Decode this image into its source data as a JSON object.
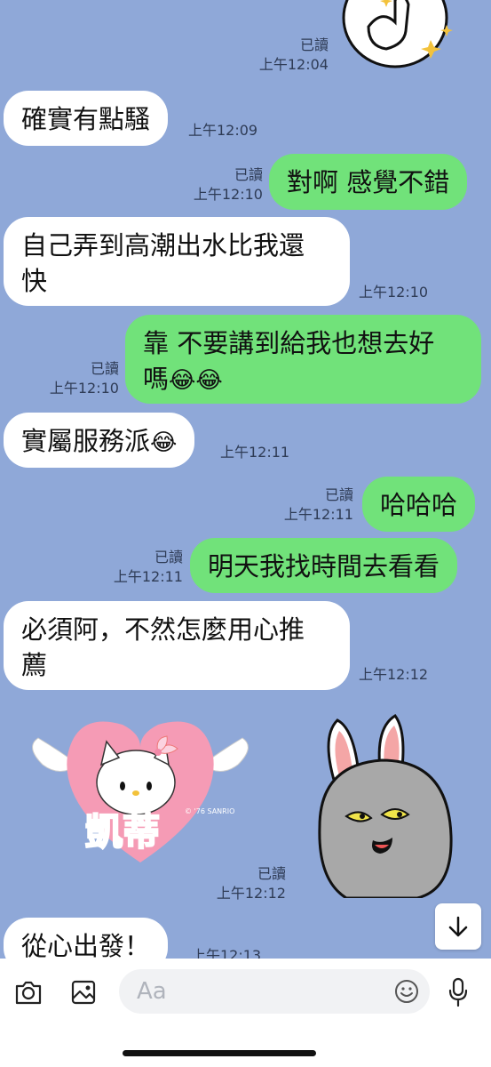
{
  "messages": [
    {
      "id": "m0",
      "dir": "out",
      "read": "已讀",
      "time": "上午12:04"
    },
    {
      "id": "m1",
      "dir": "in",
      "text": "確實有點騷",
      "time": "上午12:09"
    },
    {
      "id": "m2",
      "dir": "out",
      "text": "對啊 感覺不錯",
      "read": "已讀",
      "time": "上午12:10"
    },
    {
      "id": "m3",
      "dir": "in",
      "line1": "自己弄到高潮出水比我還",
      "line2": "快",
      "time": "上午12:10"
    },
    {
      "id": "m4",
      "dir": "out",
      "line1": "靠 不要講到給我也想去好",
      "line2": "嗎",
      "emoji": "😂😂",
      "read": "已讀",
      "time": "上午12:10"
    },
    {
      "id": "m5",
      "dir": "in",
      "text": "實屬服務派",
      "emoji": "😂",
      "time": "上午12:11"
    },
    {
      "id": "m6",
      "dir": "out",
      "text": "哈哈哈",
      "read": "已讀",
      "time": "上午12:11"
    },
    {
      "id": "m7",
      "dir": "out",
      "text": "明天我找時間去看看",
      "read": "已讀",
      "time": "上午12:11"
    },
    {
      "id": "m8",
      "dir": "in",
      "line1": "必須阿，不然怎麼用心推",
      "line2": "薦",
      "time": "上午12:12"
    },
    {
      "id": "m9",
      "dir": "in",
      "sticker_text": "凱蒂",
      "sticker_small": "© '76 SANRIO",
      "read": "已讀",
      "time": "上午12:12"
    },
    {
      "id": "m10",
      "dir": "in",
      "text": "從心出發！",
      "time": "上午12:13"
    }
  ],
  "composer": {
    "placeholder": "Aa"
  },
  "icons": {
    "camera": "camera-icon",
    "image": "image-icon",
    "emoji": "emoji-icon",
    "mic": "microphone-icon",
    "scroll": "arrow-down-icon"
  },
  "colors": {
    "background": "#8fa8d8",
    "outgoing": "#71e27a",
    "incoming": "#ffffff"
  }
}
